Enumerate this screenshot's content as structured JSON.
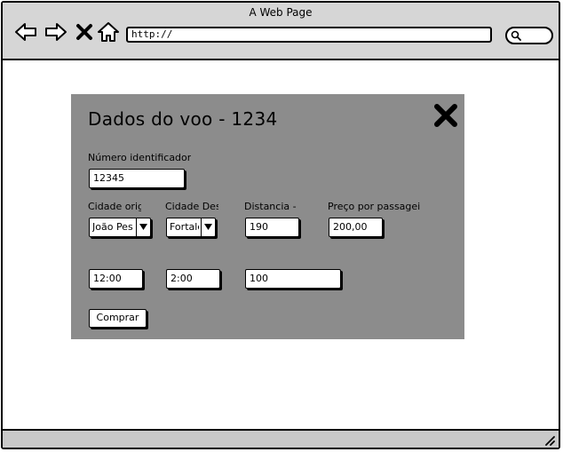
{
  "window": {
    "title": "A Web Page"
  },
  "address_bar": {
    "url": "http://"
  },
  "dialog": {
    "title": "Dados do voo - 1234",
    "id_label": "Número identificador",
    "id_value": "12345",
    "origin_label": "Cidade orig",
    "origin_value": "João Pes",
    "dest_label": "Cidade Des",
    "dest_value": "Fortale",
    "distance_label": "Distancia -",
    "distance_value": "190",
    "price_label": "Preço por passagei",
    "price_value": "200,00",
    "departure_time": "12:00",
    "duration": "2:00",
    "seats": "100",
    "buy_label": "Comprar"
  }
}
